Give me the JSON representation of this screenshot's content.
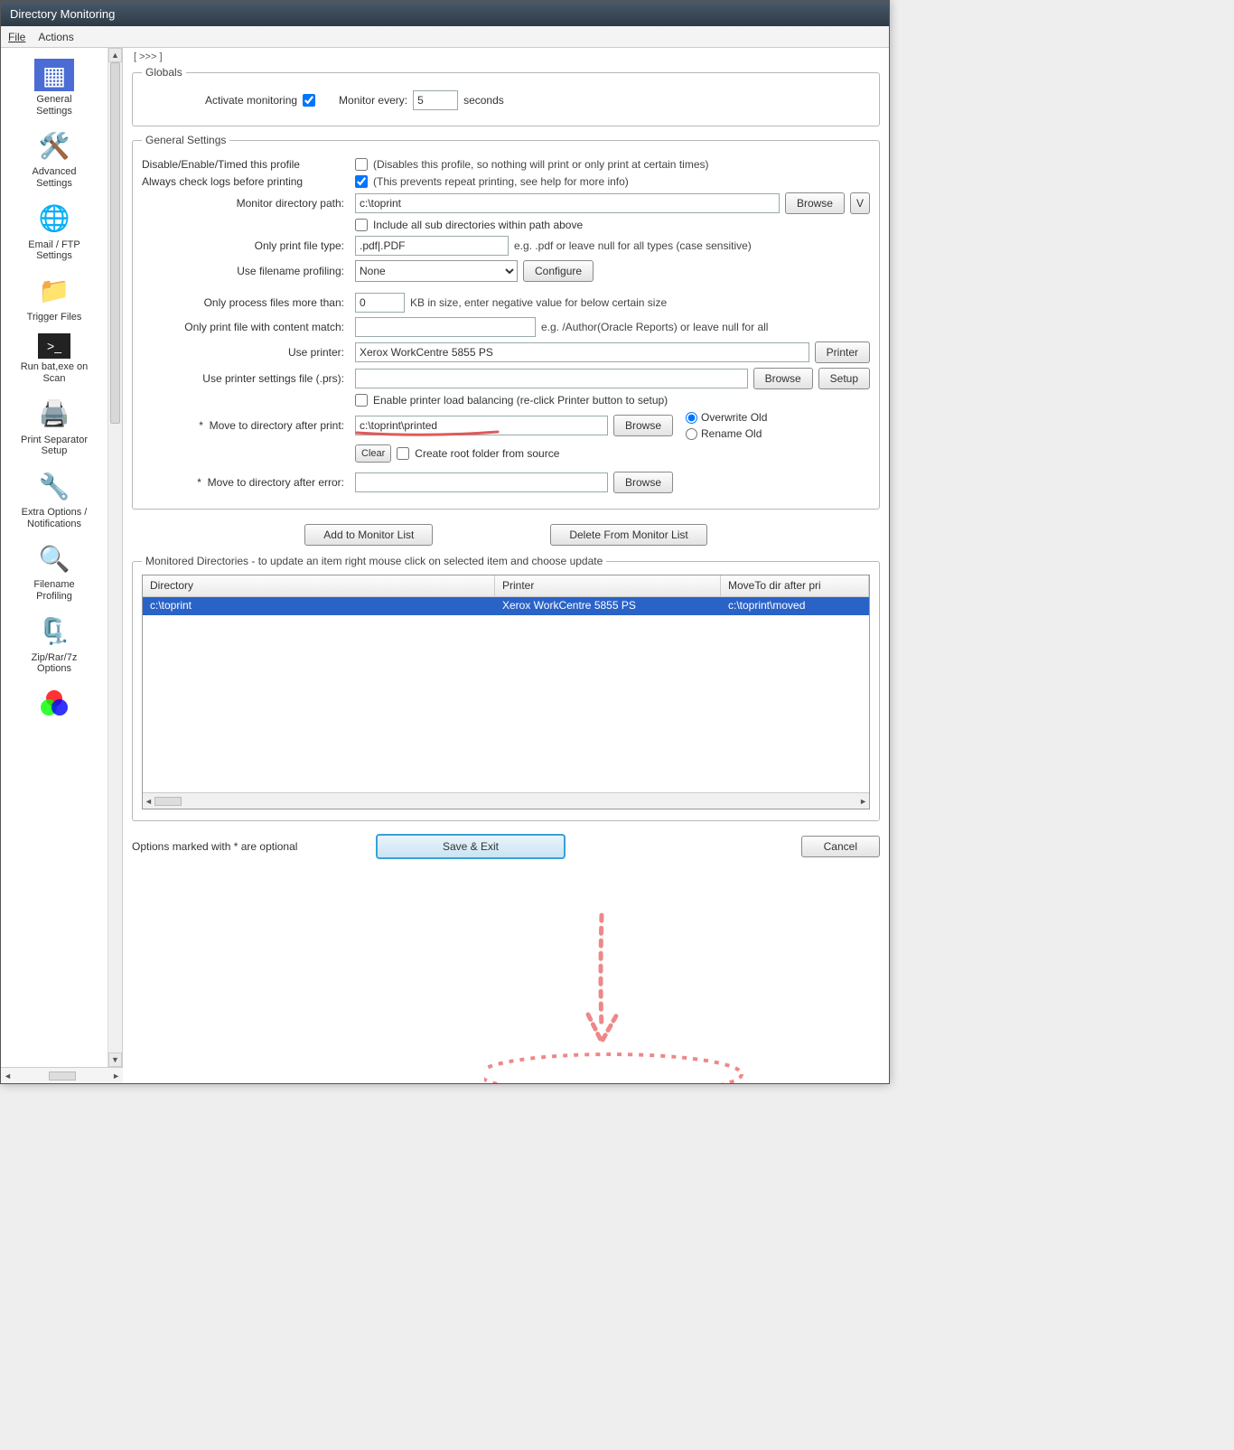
{
  "window": {
    "title": "Directory Monitoring"
  },
  "menubar": {
    "file": "File",
    "actions": "Actions"
  },
  "sidebar": {
    "items": [
      {
        "icon": "⚙️",
        "label": "General\nSettings"
      },
      {
        "icon": "🛠️",
        "label": "Advanced\nSettings"
      },
      {
        "icon": "🌐",
        "label": "Email / FTP\nSettings"
      },
      {
        "icon": "📁",
        "label": "Trigger Files"
      },
      {
        "icon": "▣",
        "label": "Run bat,exe on\nScan"
      },
      {
        "icon": "🖨️",
        "label": "Print Separator\nSetup"
      },
      {
        "icon": "🔧",
        "label": "Extra Options /\nNotifications"
      },
      {
        "icon": "🔍",
        "label": "Filename\nProfiling"
      },
      {
        "icon": "🗜️",
        "label": "Zip/Rar/7z\nOptions"
      },
      {
        "icon": "🔴",
        "label": ""
      }
    ]
  },
  "breadcrumb": "[ >>> ]",
  "globals": {
    "legend": "Globals",
    "activate_label": "Activate monitoring",
    "activate_checked": true,
    "monitor_every_label": "Monitor every:",
    "monitor_every_value": "5",
    "seconds_label": "seconds"
  },
  "general": {
    "legend": "General Settings",
    "disable_label": "Disable/Enable/Timed this profile",
    "disable_checked": false,
    "disable_hint": "(Disables this profile, so nothing will print or only print at certain times)",
    "always_check_label": "Always check logs before printing",
    "always_check_checked": true,
    "always_check_hint": "(This prevents repeat printing, see help for more info)",
    "monitor_path_label": "Monitor directory path:",
    "monitor_path_value": "c:\\toprint",
    "browse": "Browse",
    "v": "V",
    "include_sub_label": "Include all sub directories within path above",
    "include_sub_checked": false,
    "only_print_type_label": "Only print file type:",
    "only_print_type_value": ".pdf|.PDF",
    "only_print_type_hint": "e.g. .pdf or leave null for all types (case sensitive)",
    "filename_profiling_label": "Use filename profiling:",
    "filename_profiling_value": "None",
    "configure": "Configure",
    "only_size_label": "Only process files more than:",
    "only_size_value": "0",
    "only_size_hint": "KB in size, enter negative value for below certain size",
    "content_match_label": "Only print file with content match:",
    "content_match_value": "",
    "content_match_hint": "e.g. /Author(Oracle Reports) or leave null for all",
    "use_printer_label": "Use printer:",
    "use_printer_value": "Xerox WorkCentre 5855 PS",
    "printer_btn": "Printer",
    "prs_label": "Use printer settings file (.prs):",
    "prs_value": "",
    "setup": "Setup",
    "load_balancing_label": "Enable printer load balancing (re-click Printer button to setup)",
    "load_balancing_checked": false,
    "move_after_print_label": "Move to directory after print:",
    "move_after_print_value": "c:\\toprint\\printed",
    "overwrite_label": "Overwrite Old",
    "rename_label": "Rename Old",
    "clear": "Clear",
    "create_root_label": "Create root folder from source",
    "create_root_checked": false,
    "move_after_error_label": "Move to directory after error:",
    "move_after_error_value": ""
  },
  "list_buttons": {
    "add": "Add to Monitor List",
    "delete": "Delete From Monitor List"
  },
  "monitored": {
    "legend": "Monitored Directories   -   to update an item right mouse click on selected item and choose update",
    "headers": {
      "dir": "Directory",
      "printer": "Printer",
      "moveto": "MoveTo dir after pri"
    },
    "rows": [
      {
        "dir": "c:\\toprint",
        "printer": "Xerox WorkCentre 5855 PS",
        "moveto": "c:\\toprint\\moved"
      }
    ]
  },
  "footer": {
    "note": "Options marked with * are optional",
    "save": "Save & Exit",
    "cancel": "Cancel"
  }
}
